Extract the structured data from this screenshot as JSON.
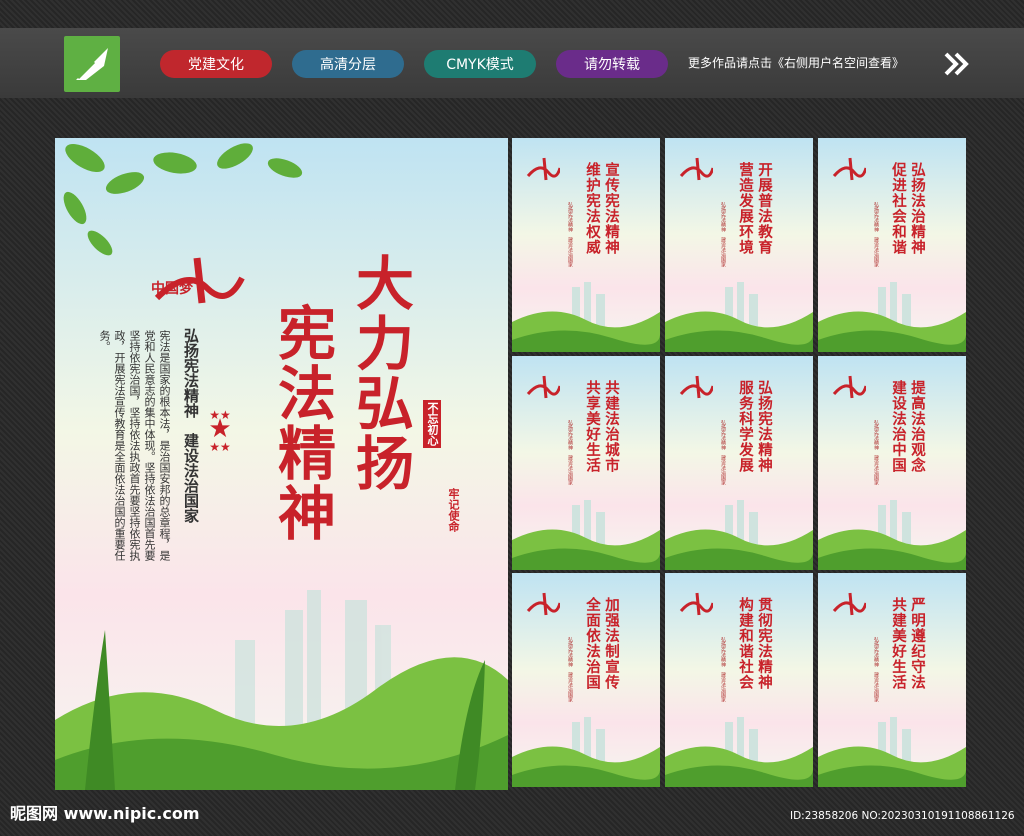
{
  "header": {
    "tags": [
      {
        "label": "党建文化",
        "color": "#c0272d"
      },
      {
        "label": "高清分层",
        "color": "#2f6c8f"
      },
      {
        "label": "CMYK模式",
        "color": "#1e7c72"
      },
      {
        "label": "请勿转载",
        "color": "#6a2c8a"
      }
    ],
    "more_text": "更多作品请点击《右侧用户名空间查看》"
  },
  "main_poster": {
    "title_line1": "大力弘扬",
    "title_line2": "宪法精神",
    "slogan": "弘扬宪法精神　建设法治国家",
    "side_note_1": "不忘初心",
    "side_note_2": "牢记使命",
    "body_text": "宪法是国家的根本法，是治国安邦的总章程，是党和人民意志的集中体现。坚持依法治国首先要坚持依宪治国，坚持依法执政首先要坚持依宪执政，开展宪法宣传教育是全面依法治国的重要任务。",
    "logo_text": "中国梦"
  },
  "small_posters": [
    {
      "line1": "宣传宪法精神",
      "line2": "维护宪法权威"
    },
    {
      "line1": "开展普法教育",
      "line2": "营造发展环境"
    },
    {
      "line1": "弘扬法治精神",
      "line2": "促进社会和谐"
    },
    {
      "line1": "共建法治城市",
      "line2": "共享美好生活"
    },
    {
      "line1": "弘扬宪法精神",
      "line2": "服务科学发展"
    },
    {
      "line1": "提高法治观念",
      "line2": "建设法治中国"
    },
    {
      "line1": "加强法制宣传",
      "line2": "全面依法治国"
    },
    {
      "line1": "贯彻宪法精神",
      "line2": "构建和谐社会"
    },
    {
      "line1": "严明遵纪守法",
      "line2": "共建美好生活"
    }
  ],
  "small_sub": "弘扬宪法精神　建设法治国家",
  "footer": {
    "site": "昵图网 www.nipic.com",
    "id_text": "ID:23858206 NO:20230310191108861126"
  }
}
